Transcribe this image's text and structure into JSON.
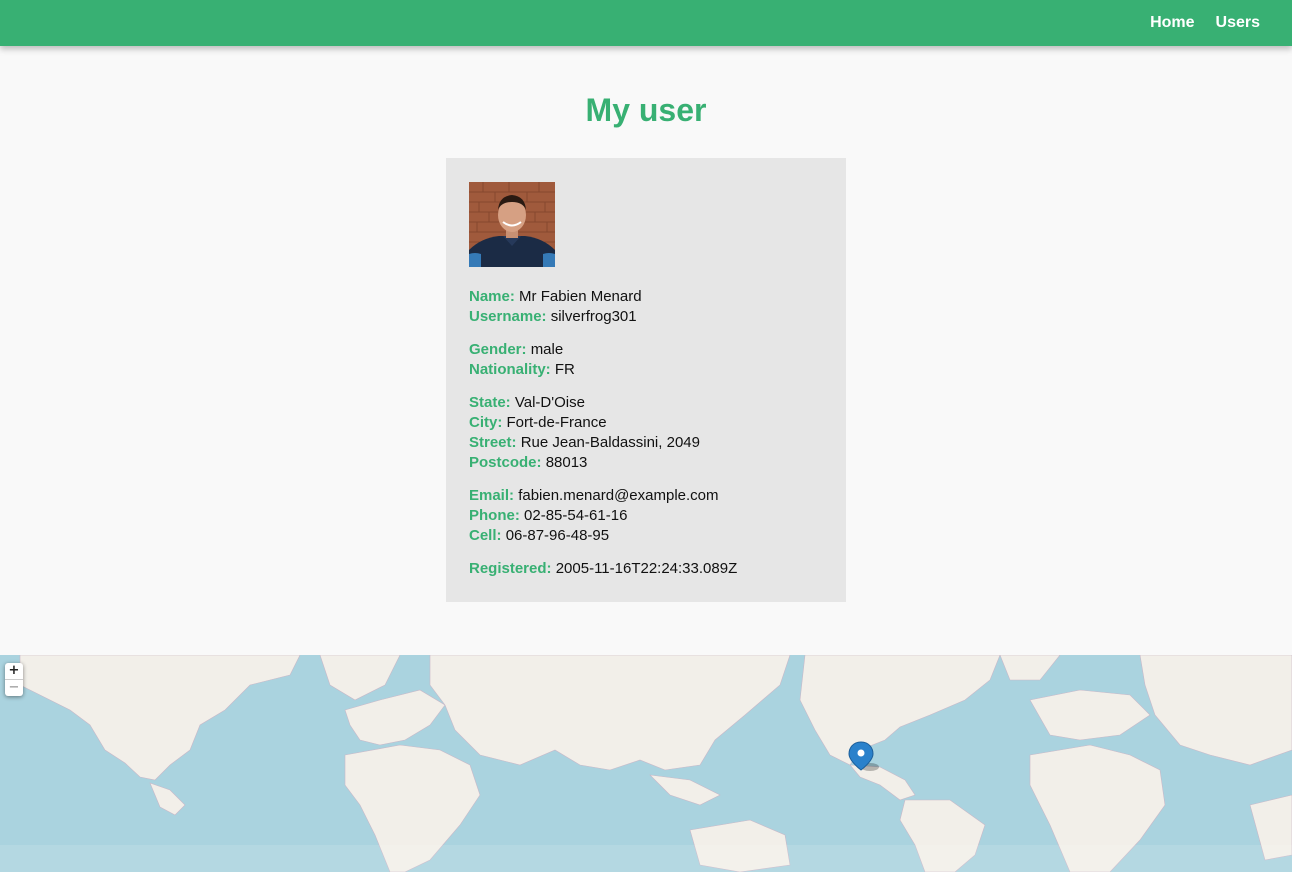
{
  "nav": {
    "links": [
      {
        "label": "Home"
      },
      {
        "label": "Users"
      }
    ]
  },
  "page": {
    "title": "My user"
  },
  "user": {
    "name": {
      "label": "Name:",
      "value": "Mr Fabien Menard"
    },
    "username": {
      "label": "Username:",
      "value": "silverfrog301"
    },
    "gender": {
      "label": "Gender:",
      "value": "male"
    },
    "nationality": {
      "label": "Nationality:",
      "value": "FR"
    },
    "state": {
      "label": "State:",
      "value": "Val-D'Oise"
    },
    "city": {
      "label": "City:",
      "value": "Fort-de-France"
    },
    "street": {
      "label": "Street:",
      "value": "Rue Jean-Baldassini, 2049"
    },
    "postcode": {
      "label": "Postcode:",
      "value": "88013"
    },
    "email": {
      "label": "Email:",
      "value": "fabien.menard@example.com"
    },
    "phone": {
      "label": "Phone:",
      "value": "02-85-54-61-16"
    },
    "cell": {
      "label": "Cell:",
      "value": "06-87-96-48-95"
    },
    "registered": {
      "label": "Registered:",
      "value": "2005-11-16T22:24:33.089Z"
    }
  },
  "map": {
    "zoom_in": "+",
    "zoom_out": "−",
    "marker_icon": "map-pin-icon"
  },
  "colors": {
    "accent": "#38b073",
    "card_bg": "#e6e6e6",
    "page_bg": "#f9f9f9",
    "water": "#aad3df",
    "land": "#f2efe9",
    "marker": "#2a81cb"
  }
}
